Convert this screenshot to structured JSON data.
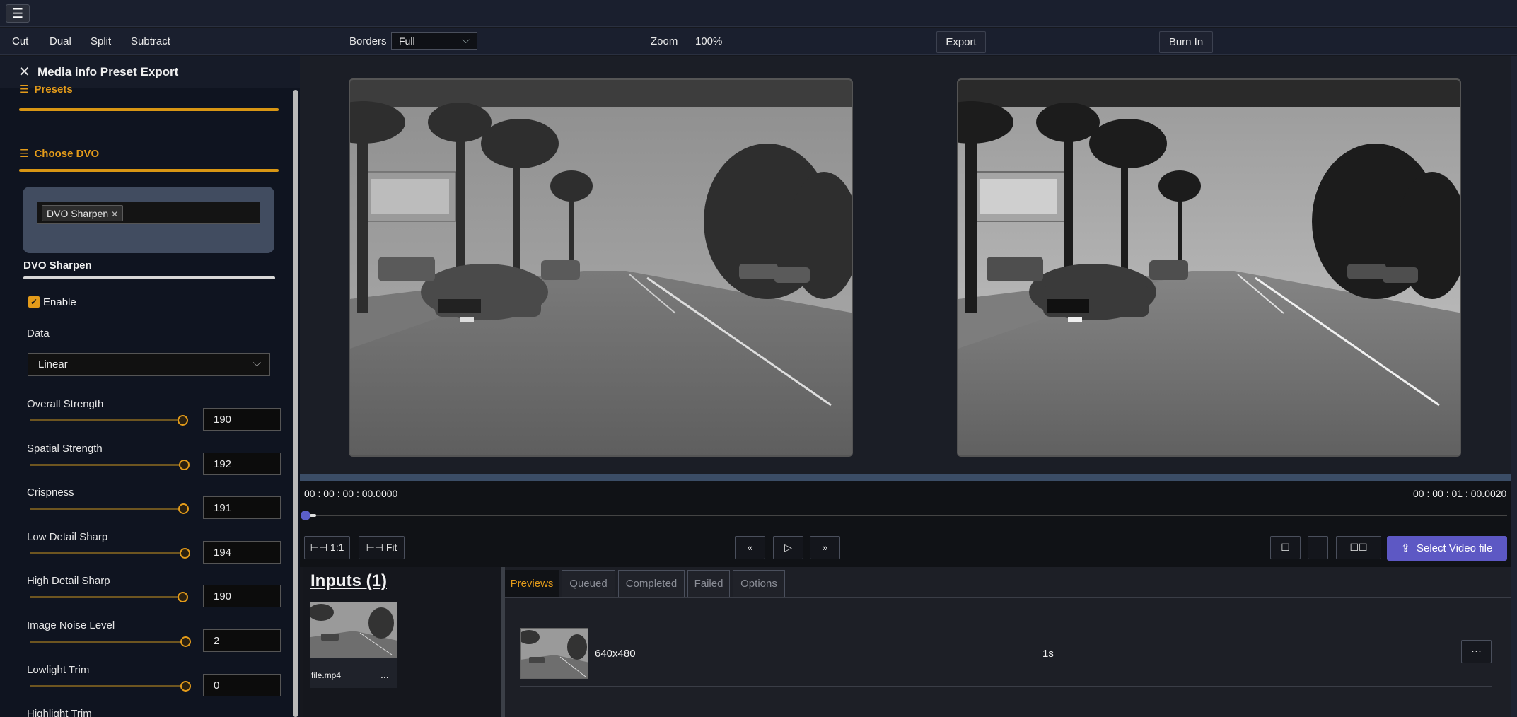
{
  "toolbar": {
    "modes": [
      "Cut",
      "Dual",
      "Split",
      "Subtract"
    ],
    "borders_label": "Borders",
    "borders_value": "Full",
    "zoom_label": "Zoom",
    "zoom_value": "100%",
    "export_label": "Export",
    "burnin_label": "Burn In"
  },
  "sidebar": {
    "title": "Media info Preset Export",
    "presets_label": "Presets",
    "choose_dvo_label": "Choose DVO",
    "dvo_chip": "DVO Sharpen",
    "dvo_section": "DVO Sharpen",
    "enable_label": "Enable",
    "data_label": "Data",
    "data_value": "Linear",
    "sliders": [
      {
        "label": "Overall Strength",
        "value": "190",
        "fraction": 0.98
      },
      {
        "label": "Spatial Strength",
        "value": "192",
        "fraction": 0.99
      },
      {
        "label": "Crispness",
        "value": "191",
        "fraction": 0.985
      },
      {
        "label": "Low Detail Sharp",
        "value": "194",
        "fraction": 0.995
      },
      {
        "label": "High Detail Sharp",
        "value": "190",
        "fraction": 0.98
      },
      {
        "label": "Image Noise Level",
        "value": "2",
        "fraction": 1.0
      },
      {
        "label": "Lowlight Trim",
        "value": "0",
        "fraction": 1.0
      },
      {
        "label": "Highlight Trim",
        "value": "",
        "fraction": 1.0
      }
    ]
  },
  "timeline": {
    "start_tc": "00 : 00 : 00 : 00.0000",
    "end_tc": "00 : 00 : 01 : 00.0020",
    "zoom_1to1": "1:1",
    "zoom_fit": "Fit",
    "select_video": "Select Video file"
  },
  "inputs": {
    "title": "Inputs (1)",
    "file_name": "file.mp4",
    "more": "..."
  },
  "jobs": {
    "tabs": [
      "Previews",
      "Queued",
      "Completed",
      "Failed",
      "Options"
    ],
    "active_tab": "Previews",
    "row": {
      "resolution": "640x480",
      "duration": "1s",
      "more": "···"
    }
  },
  "colors": {
    "accent": "#e39b1a",
    "primary_button": "#5d58c4"
  }
}
